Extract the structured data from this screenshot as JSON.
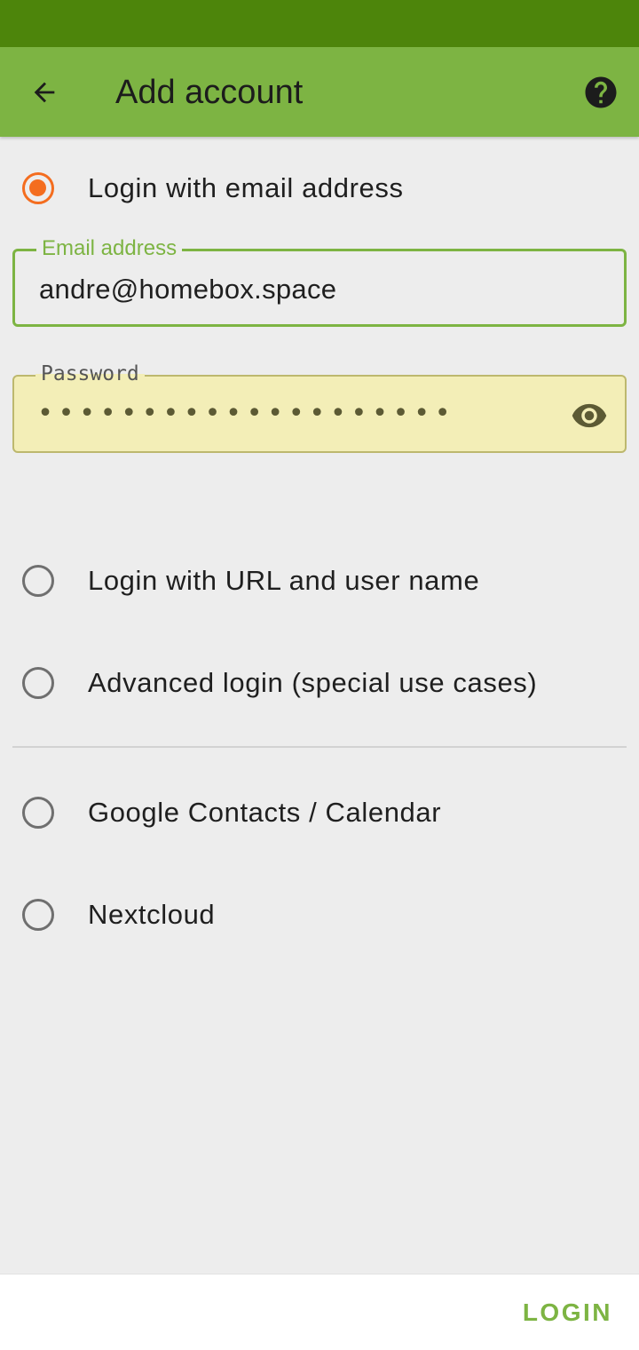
{
  "app_bar": {
    "title": "Add account",
    "back_icon": "arrow-back-icon",
    "help_icon": "help-circle-icon"
  },
  "login_options": {
    "email": {
      "label": "Login with email address",
      "selected": true
    },
    "url": {
      "label": "Login with URL and user name",
      "selected": false
    },
    "advanced": {
      "label": "Advanced login (special use cases)",
      "selected": false
    },
    "google": {
      "label": "Google Contacts / Calendar",
      "selected": false
    },
    "nextcloud": {
      "label": "Nextcloud",
      "selected": false
    }
  },
  "email_field": {
    "label": "Email address",
    "value": "andre@homebox.space"
  },
  "password_field": {
    "label": "Password",
    "masked_value": "••••••••••••••••••••",
    "toggle_icon": "eye-icon"
  },
  "footer": {
    "login_label": "LOGIN"
  },
  "colors": {
    "status_bar": "#4d850b",
    "app_bar": "#7db443",
    "radio_selected": "#f46d1f",
    "autofill_bg": "#f3eeb7"
  }
}
